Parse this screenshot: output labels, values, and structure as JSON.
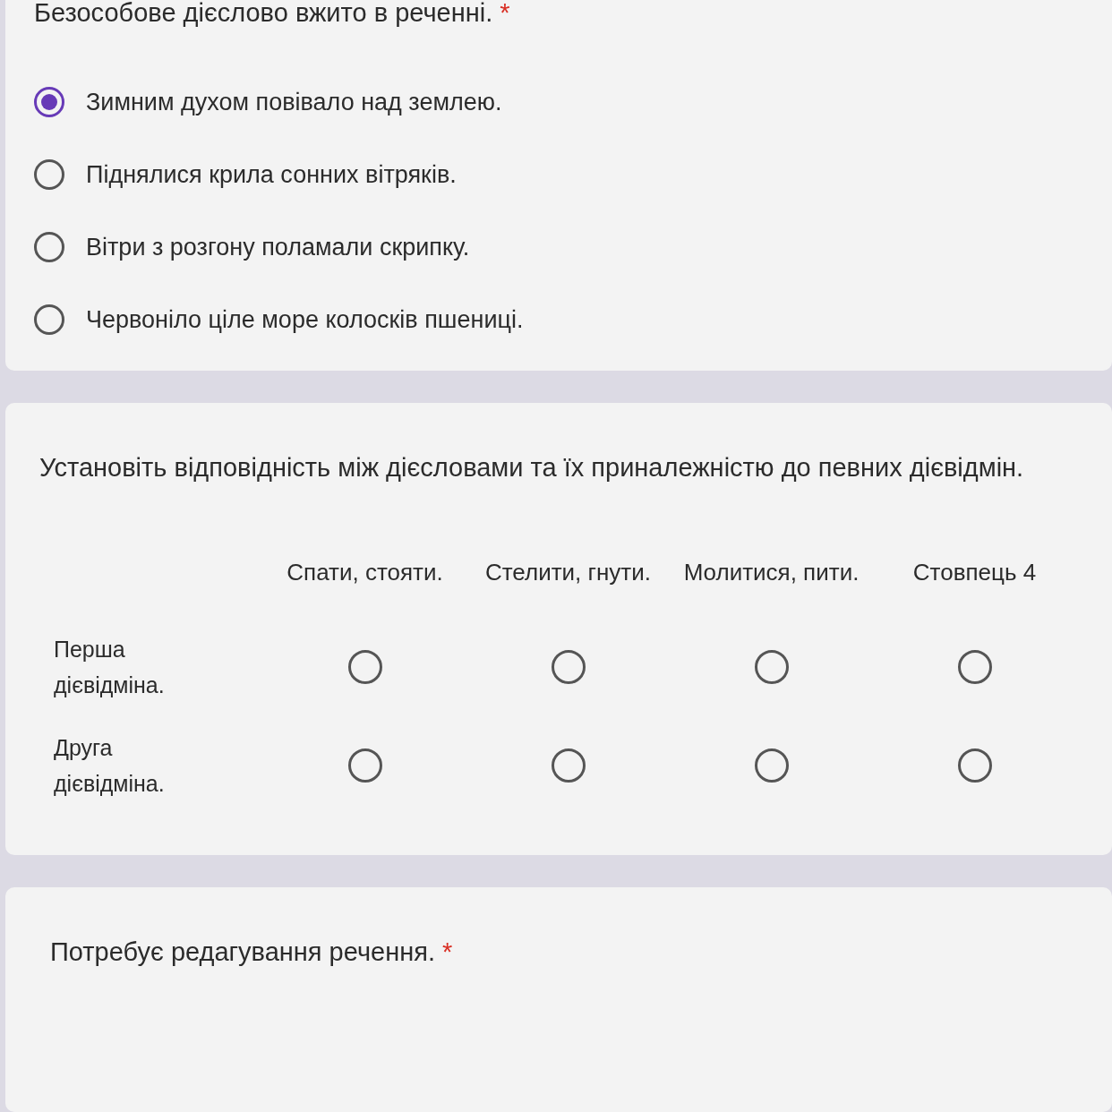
{
  "questions": [
    {
      "kind": "choice",
      "title": "Безособове дієслово вжито в реченні.",
      "asterisk": "*",
      "options": [
        {
          "label": "Зимним духом повівало над землею.",
          "selected": true
        },
        {
          "label": "Піднялися крила сонних вітряків.",
          "selected": false
        },
        {
          "label": "Вітри з розгону поламали скрипку.",
          "selected": false
        },
        {
          "label": "Червоніло ціле море колосків пшениці.",
          "selected": false
        }
      ]
    },
    {
      "kind": "grid",
      "title": "Установіть відповідність між дієсловами та їх приналежністю до певних дієвідмін.",
      "columns": [
        "Спати, стояти.",
        "Стелити, гнути.",
        "Молитися, пити.",
        "Стовпець 4"
      ],
      "rows": [
        {
          "label": "Перша дієвідміна.",
          "cells": [
            {
              "selected": false
            },
            {
              "selected": false
            },
            {
              "selected": false
            },
            {
              "selected": false
            }
          ]
        },
        {
          "label": "Друга дієвідміна.",
          "cells": [
            {
              "selected": false
            },
            {
              "selected": false
            },
            {
              "selected": false
            },
            {
              "selected": false
            }
          ]
        }
      ]
    },
    {
      "kind": "title",
      "title": "Потребує редагування речення.",
      "asterisk": "*"
    }
  ]
}
